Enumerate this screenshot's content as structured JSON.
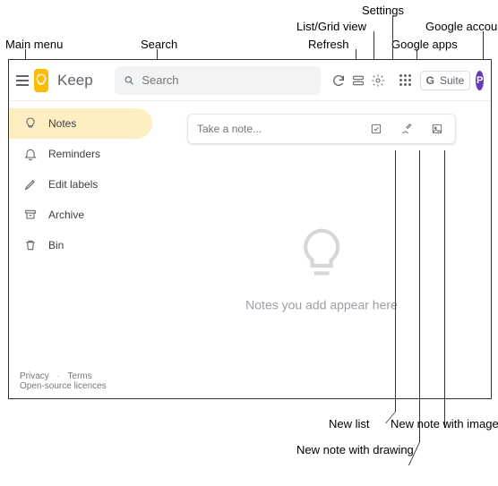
{
  "annotations": {
    "main_menu": "Main menu",
    "search": "Search",
    "refresh": "Refresh",
    "list_grid": "List/Grid view",
    "settings": "Settings",
    "google_apps": "Google apps",
    "google_account": "Google account",
    "new_list": "New list",
    "new_note_drawing": "New note with drawing",
    "new_note_image": "New note with image"
  },
  "header": {
    "brand": "Keep",
    "search_placeholder": "Search",
    "suite_prefix": "G",
    "suite_word": "Suite",
    "avatar_initial": "P"
  },
  "sidebar": {
    "items": [
      {
        "label": "Notes"
      },
      {
        "label": "Reminders"
      },
      {
        "label": "Edit labels"
      },
      {
        "label": "Archive"
      },
      {
        "label": "Bin"
      }
    ]
  },
  "note_input": {
    "placeholder": "Take a note..."
  },
  "empty_state": {
    "message": "Notes you add appear here"
  },
  "footer": {
    "privacy": "Privacy",
    "dot": "·",
    "terms": "Terms",
    "licences": "Open-source licences"
  }
}
